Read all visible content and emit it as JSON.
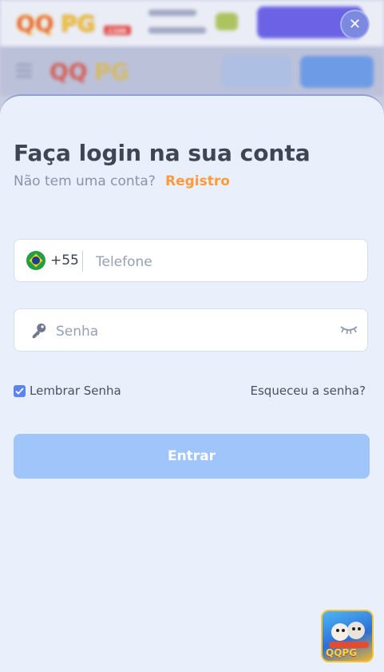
{
  "background": {
    "logo_text": "QQPG",
    "logo_suffix": ".COM"
  },
  "modal": {
    "close_symbol": "✕",
    "title": "Faça login na sua conta",
    "subtitle": "Não tem uma conta?",
    "register_link": "Registro",
    "phone": {
      "country_code": "+55",
      "placeholder": "Telefone",
      "flag_icon": "brazil-flag-icon"
    },
    "password": {
      "placeholder": "Senha",
      "icon": "key-icon",
      "toggle_icon": "eye-closed-icon"
    },
    "remember_label": "Lembrar Senha",
    "remember_checked": true,
    "forgot_link": "Esqueceu a senha?",
    "submit_label": "Entrar"
  },
  "app_badge": {
    "text": "QQPG"
  },
  "colors": {
    "accent": "#5b84ee",
    "register": "#ff9a3c",
    "submit_bg": "#9fc5fb",
    "sheet_bg": "#e9f0fc"
  }
}
